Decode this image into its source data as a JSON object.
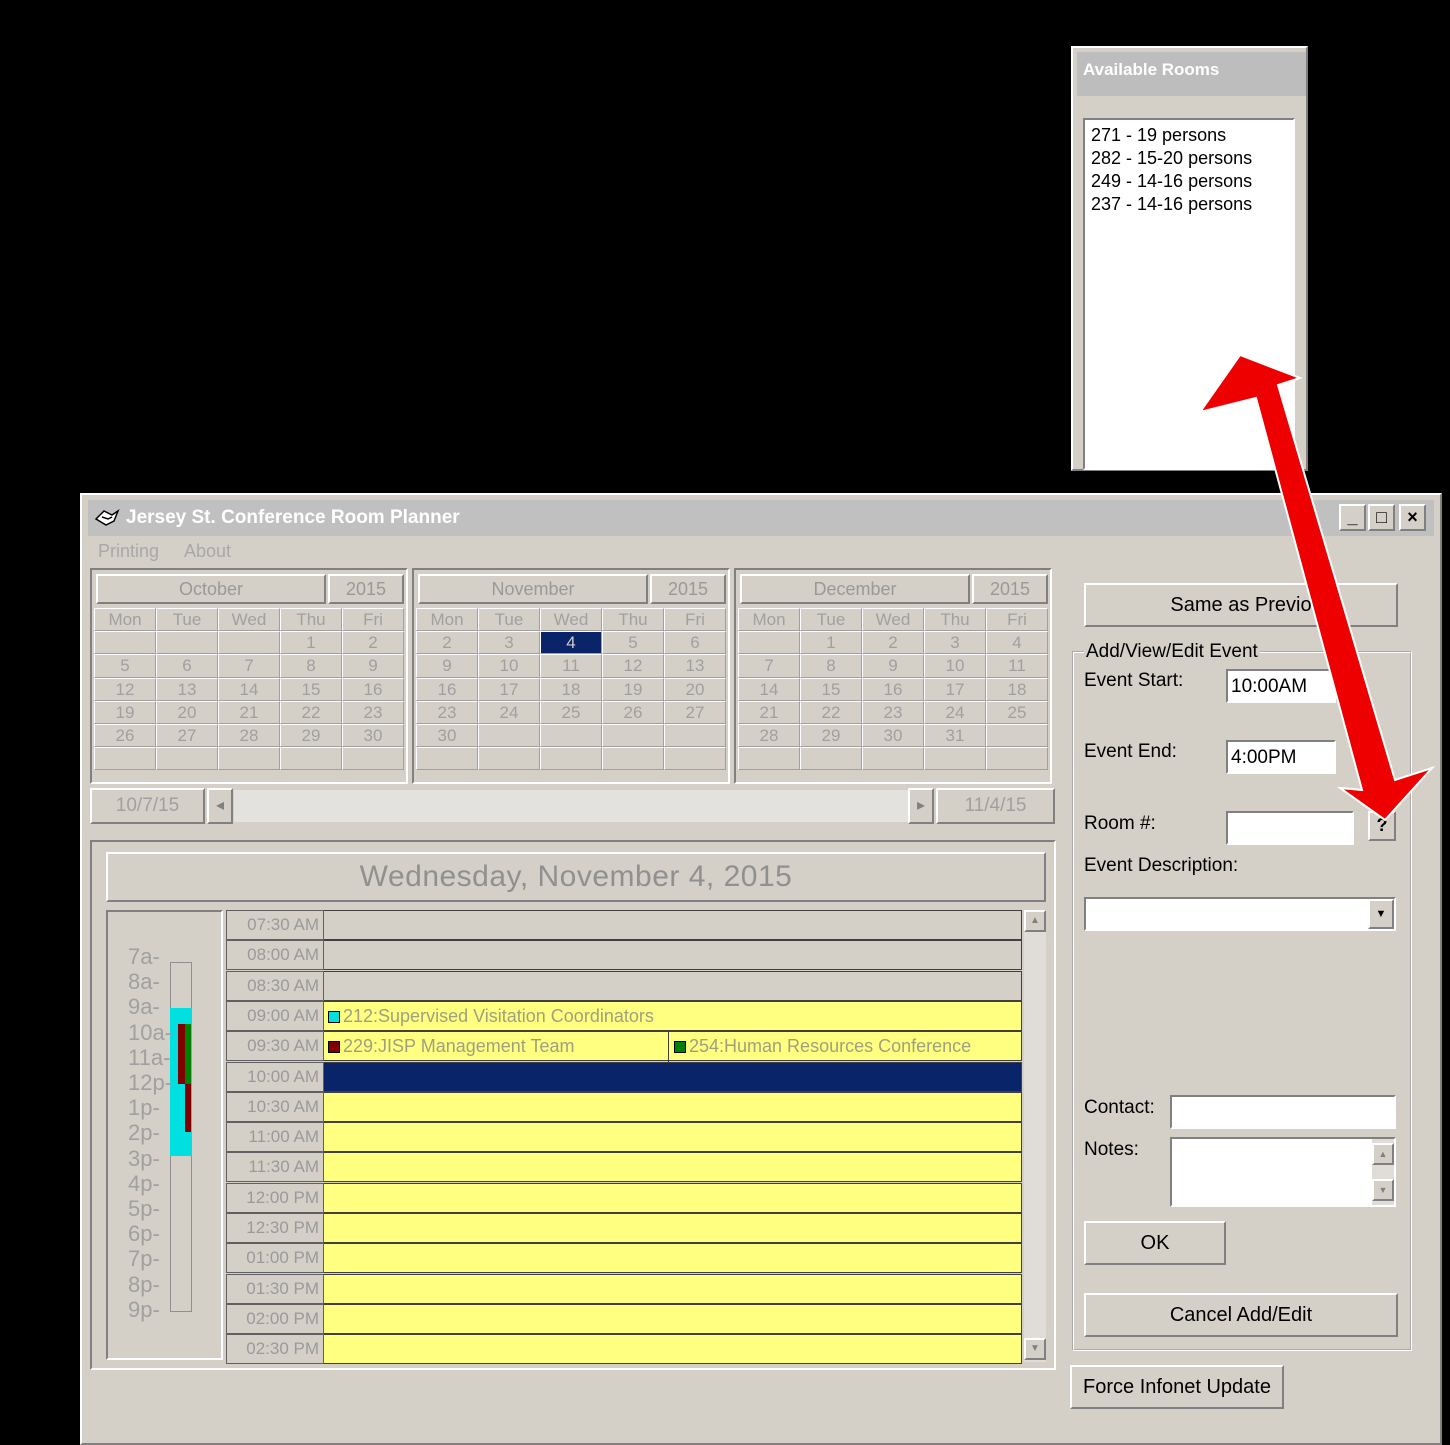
{
  "rooms_popup": {
    "title": "Available Rooms",
    "items": [
      "271 - 19 persons",
      "282 - 15-20 persons",
      "249 - 14-16 persons",
      "237 - 14-16 persons"
    ]
  },
  "window": {
    "title": "Jersey St. Conference Room Planner",
    "minimize": "_",
    "maximize": "□",
    "close": "×"
  },
  "menu": [
    "Printing",
    "About"
  ],
  "calendars": [
    {
      "month": "October",
      "year": "2015",
      "days": [
        "Mon",
        "Tue",
        "Wed",
        "Thu",
        "Fri"
      ],
      "cells": [
        "",
        "",
        "",
        "1",
        "2",
        "5",
        "6",
        "7",
        "8",
        "9",
        "12",
        "13",
        "14",
        "15",
        "16",
        "19",
        "20",
        "21",
        "22",
        "23",
        "26",
        "27",
        "28",
        "29",
        "30",
        "",
        "",
        "",
        "",
        ""
      ]
    },
    {
      "month": "November",
      "year": "2015",
      "days": [
        "Mon",
        "Tue",
        "Wed",
        "Thu",
        "Fri"
      ],
      "cells": [
        "2",
        "3",
        "4",
        "5",
        "6",
        "9",
        "10",
        "11",
        "12",
        "13",
        "16",
        "17",
        "18",
        "19",
        "20",
        "23",
        "24",
        "25",
        "26",
        "27",
        "30",
        "",
        "",
        "",
        "",
        "",
        "",
        "",
        "",
        ""
      ],
      "selected": "4"
    },
    {
      "month": "December",
      "year": "2015",
      "days": [
        "Mon",
        "Tue",
        "Wed",
        "Thu",
        "Fri"
      ],
      "cells": [
        "",
        "1",
        "2",
        "3",
        "4",
        "7",
        "8",
        "9",
        "10",
        "11",
        "14",
        "15",
        "16",
        "17",
        "18",
        "21",
        "22",
        "23",
        "24",
        "25",
        "28",
        "29",
        "30",
        "31",
        "",
        "",
        "",
        "",
        "",
        ""
      ]
    }
  ],
  "nav": {
    "prev_date": "10/7/15",
    "next_date": "11/4/15",
    "prev_arrow": "◂",
    "next_arrow": "▸"
  },
  "day_title": "Wednesday, November 4, 2015",
  "mini_hours": [
    "7a-",
    "8a-",
    "9a-",
    "10a-",
    "11a-",
    "12p-",
    "1p-",
    "2p-",
    "3p-",
    "4p-",
    "5p-",
    "6p-",
    "7p-",
    "8p-",
    "9p-"
  ],
  "slots": [
    "07:30 AM",
    "08:00 AM",
    "08:30 AM",
    "09:00 AM",
    "09:30 AM",
    "10:00 AM",
    "10:30 AM",
    "11:00 AM",
    "11:30 AM",
    "12:00 PM",
    "12:30 PM",
    "01:00 PM",
    "01:30 PM",
    "02:00 PM",
    "02:30 PM"
  ],
  "events": [
    {
      "slot": "09:00 AM",
      "text": "212:Supervised Visitation Coordinators",
      "color": "#00e0e0"
    },
    {
      "slot": "09:30 AM",
      "text": "229:JISP Management Team",
      "color": "#800000"
    },
    {
      "slot": "09:30 AM",
      "text": "254:Human Resources Conference",
      "color": "#008000"
    }
  ],
  "colors": {
    "slot_fill": "#ffff80",
    "selected_slot": "#0a246a",
    "arrow": "#ee0000"
  },
  "panel": {
    "same_as_prev": "Same as Previo",
    "group_label": "Add/View/Edit Event",
    "event_start_label": "Event Start:",
    "event_start_value": "10:00AM",
    "event_end_label": "Event End:",
    "event_end_value": "4:00PM",
    "room_label": "Room #:",
    "room_value": "",
    "help": "?",
    "desc_label": "Event Description:",
    "desc_value": "",
    "contact_label": "Contact:",
    "notes_label": "Notes:",
    "ok": "OK",
    "cancel": "Cancel Add/Edit",
    "force_update": "Force Infonet Update"
  }
}
